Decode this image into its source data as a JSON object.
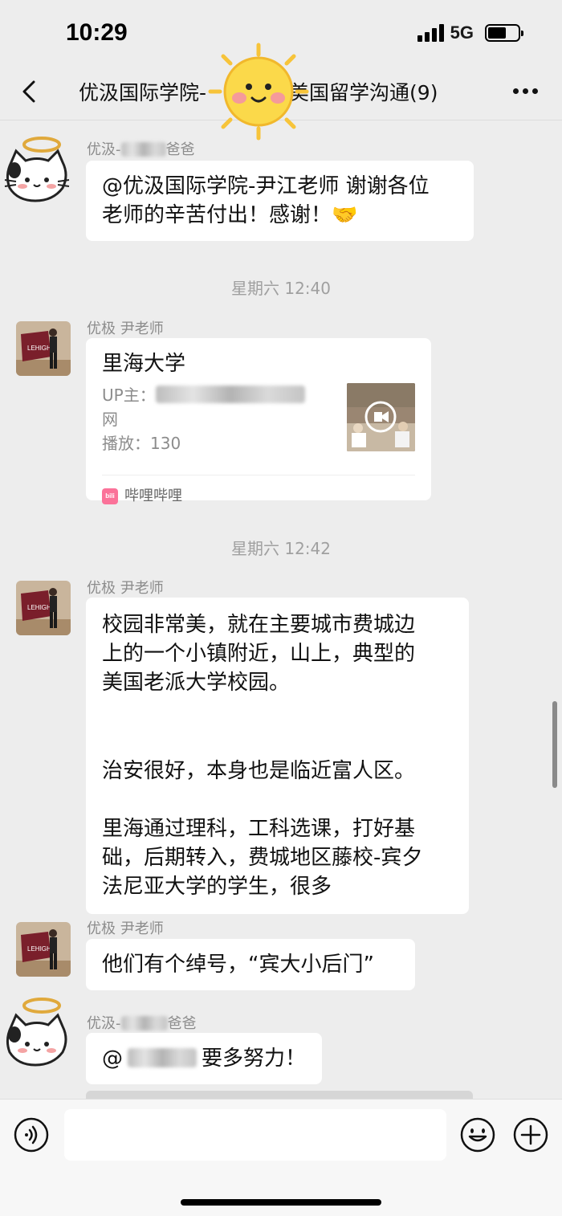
{
  "status_bar": {
    "time": "10:29",
    "network": "5G",
    "battery_level": 0.6
  },
  "nav": {
    "back_icon": "chevron-left-icon",
    "title_part1": "优汲国际学院-",
    "title_part2": "-美国留学沟通(9)",
    "sticker": "sun-face-sticker",
    "more_icon": "more-dots-icon"
  },
  "messages": [
    {
      "type": "text",
      "sender_prefix": "优汲-",
      "sender_suffix": "爸爸",
      "avatar": "cat-angel-avatar",
      "lines": [
        "@优汲国际学院-尹江老师 谢谢各位",
        "老师的辛苦付出！感谢！🤝"
      ]
    },
    {
      "type": "time",
      "text": "星期六 12:40"
    },
    {
      "type": "card",
      "sender": "优极 尹老师",
      "avatar": "teacher-flag-avatar",
      "title": "里海大学",
      "up_label": "UP主：",
      "up_suffix": "网",
      "plays": "播放：130",
      "source": "哔哩哔哩",
      "source_icon": "bilibili-icon"
    },
    {
      "type": "time",
      "text": "星期六 12:42"
    },
    {
      "type": "text",
      "sender": "优极 尹老师",
      "avatar": "teacher-flag-avatar",
      "lines": [
        "校园非常美，就在主要城市费城边",
        "上的一个小镇附近，山上，典型的",
        "美国老派大学校园。",
        "",
        "",
        "治安很好，本身也是临近富人区。",
        "",
        "里海通过理科，工科选课，打好基",
        "础，后期转入，费城地区藤校-宾夕",
        "法尼亚大学的学生，很多"
      ]
    },
    {
      "type": "text",
      "sender": "优极 尹老师",
      "avatar": "teacher-flag-avatar",
      "lines": [
        "他们有个绰号，“宾大小后门”"
      ]
    },
    {
      "type": "text",
      "sender_prefix": "优汲-",
      "sender_suffix": "爸爸",
      "avatar": "cat-angel-avatar",
      "at": "@",
      "text_after": "要多努力！"
    }
  ],
  "input_bar": {
    "voice_icon": "voice-icon",
    "emoji_icon": "emoji-icon",
    "plus_icon": "plus-icon",
    "input_value": ""
  }
}
